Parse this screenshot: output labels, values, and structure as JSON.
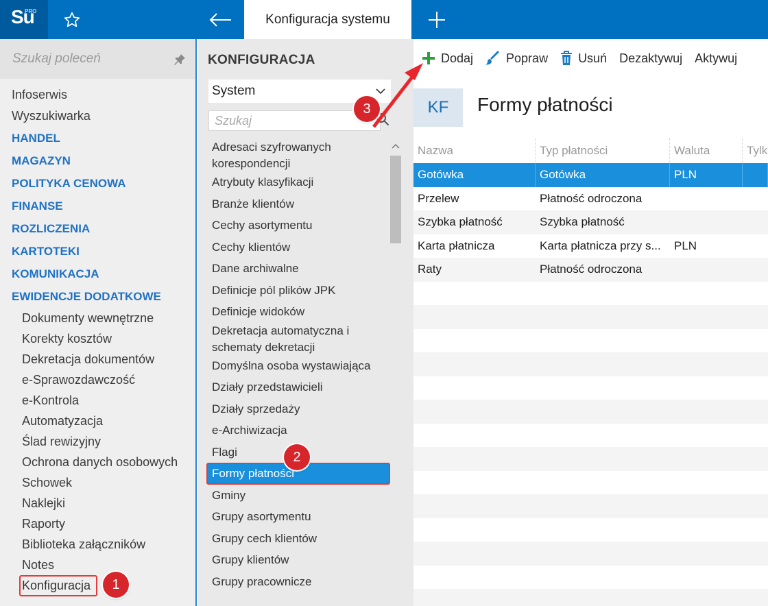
{
  "app": {
    "logo": "Su",
    "logo_badge": "PRO",
    "active_tab": "Konfiguracja systemu"
  },
  "leftnav": {
    "search_placeholder": "Szukaj poleceń",
    "top_items": [
      "Infoserwis",
      "Wyszukiwarka"
    ],
    "categories": [
      "HANDEL",
      "MAGAZYN",
      "POLITYKA CENOWA",
      "FINANSE",
      "ROZLICZENIA",
      "KARTOTEKI",
      "KOMUNIKACJA",
      "EWIDENCJE DODATKOWE"
    ],
    "sub_items": [
      "Dokumenty wewnętrzne",
      "Korekty kosztów",
      "Dekretacja dokumentów",
      "e-Sprawozdawczość",
      "e-Kontrola",
      "Automatyzacja",
      "Ślad rewizyjny",
      "Ochrona danych osobowych",
      "Schowek",
      "Naklejki",
      "Raporty",
      "Biblioteka załączników",
      "Notes",
      "Konfiguracja"
    ]
  },
  "config": {
    "title": "KONFIGURACJA",
    "select_value": "System",
    "search_placeholder": "Szukaj",
    "items": [
      "Adresaci szyfrowanych korespondencji",
      "Atrybuty klasyfikacji",
      "Branże klientów",
      "Cechy asortymentu",
      "Cechy klientów",
      "Dane archiwalne",
      "Definicje pól plików JPK",
      "Definicje widoków",
      "Dekretacja automatyczna i schematy dekretacji",
      "Domyślna osoba wystawiająca",
      "Działy przedstawicieli",
      "Działy sprzedaży",
      "e-Archiwizacja",
      "Flagi",
      "Formy płatności",
      "Gminy",
      "Grupy asortymentu",
      "Grupy cech klientów",
      "Grupy klientów",
      "Grupy pracownicze"
    ]
  },
  "toolbar": {
    "add": "Dodaj",
    "edit": "Popraw",
    "delete": "Usuń",
    "deactivate": "Dezaktywuj",
    "activate": "Aktywuj"
  },
  "header": {
    "badge": "KF",
    "title": "Formy płatności"
  },
  "grid": {
    "columns": [
      "Nazwa",
      "Typ płatności",
      "Waluta",
      "Tylk"
    ],
    "rows": [
      [
        "Gotówka",
        "Gotówka",
        "PLN",
        ""
      ],
      [
        "Przelew",
        "Płatność odroczona",
        "",
        ""
      ],
      [
        "Szybka płatność",
        "Szybka płatność",
        "",
        ""
      ],
      [
        "Karta płatnicza",
        "Karta płatnicza przy s...",
        "PLN",
        ""
      ],
      [
        "Raty",
        "Płatność odroczona",
        "",
        ""
      ]
    ]
  },
  "annotations": [
    "1",
    "2",
    "3"
  ],
  "colors": {
    "topbar": "#0070c0",
    "accent": "#1a8fdc",
    "category": "#1f72c4",
    "annotation": "#d7262b",
    "add_icon": "#2e9e3e"
  }
}
